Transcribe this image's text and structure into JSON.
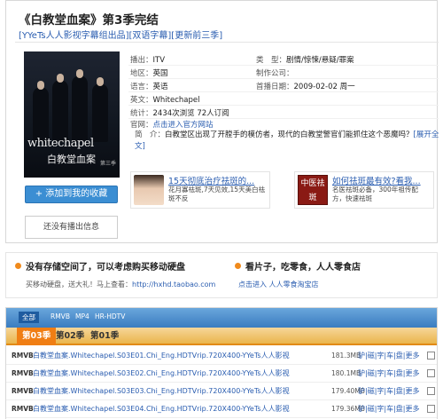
{
  "show": {
    "title": "《白教堂血案》第3季完结",
    "subtitle": "[YYeTs人人影视字幕组出品][双语字幕][更新前三季]"
  },
  "poster": {
    "title_en": "whitechapel",
    "title_cn": "白教堂血案",
    "tag": "第三季"
  },
  "info": {
    "rows_left": [
      {
        "label": "播出：",
        "value": "ITV"
      },
      {
        "label": "地区：",
        "value": "英国"
      },
      {
        "label": "语言：",
        "value": "英语"
      },
      {
        "label": "英文：",
        "value": "Whitechapel"
      },
      {
        "label": "统计：",
        "value": "2434次浏览 72人订阅"
      },
      {
        "label": "官网：",
        "value": "点击进入官方网站"
      }
    ],
    "rows_right": [
      {
        "label": "类　型：",
        "value": "剧情/惊悚/悬疑/罪案"
      },
      {
        "label": "制作公司：",
        "value": ""
      },
      {
        "label": "首播日期：",
        "value": "2009-02-02  周一"
      }
    ],
    "synopsis_label": "简　介：",
    "synopsis_text": "白教堂区出现了开膛手的模仿者，现代的白教堂警官们能抓住这个恶魔吗？",
    "synopsis_more": "[展开全文]"
  },
  "buttons": {
    "add_favorite": "+ 添加到我的收藏",
    "no_schedule": "还没有播出信息"
  },
  "ads": [
    {
      "headline": "15天彻底治疗祛斑的...",
      "body": "花月寡祛斑,7天见效,15天美白祛斑不反"
    },
    {
      "headline": "如何祛斑最有效?看我...",
      "body": "名医祛斑必备，300年祖传配方，快速祛斑",
      "thumb_text": "中医祛斑"
    }
  ],
  "promo": {
    "left_head": "没有存储空间了，可以考虑购买移动硬盘",
    "left_sub": "买移动硬盘，送大礼！马上查看：",
    "left_link": "http://hxhd.taobao.com",
    "right_head": "看片子，吃零食，人人零食店",
    "right_sub": "点击进入 人人零食淘宝店"
  },
  "resources": {
    "formats": [
      "全部",
      "RMVB",
      "MP4",
      "HR-HDTV"
    ],
    "seasons": [
      "第03季",
      "第02季",
      "第01季"
    ],
    "files": [
      {
        "format": "RMVB",
        "name": "白教堂血案.Whitechapel.S03E01.Chi_Eng.HDTVrip.720X400-YYeTs人人影视",
        "size": "181.3MB",
        "actions": "驴|磁|字|车|盘|更多"
      },
      {
        "format": "RMVB",
        "name": "白教堂血案.Whitechapel.S03E02.Chi_Eng.HDTVrip.720X400-YYeTs人人影视",
        "size": "180.1MB",
        "actions": "驴|磁|字|车|盘|更多"
      },
      {
        "format": "RMVB",
        "name": "白教堂血案.Whitechapel.S03E03.Chi_Eng.HDTVrip.720X400-YYeTs人人影视",
        "size": "179.40MB",
        "actions": "驴|磁|字|车|盘|更多"
      },
      {
        "format": "RMVB",
        "name": "白教堂血案.Whitechapel.S03E04.Chi_Eng.HDTVrip.720X400-YYeTs人人影视",
        "size": "179.36MB",
        "actions": "驴|磁|字|车|盘|更多"
      }
    ]
  },
  "colors": {
    "link": "#2a5db0",
    "accent_orange": "#f07e14",
    "button_blue": "#3b8ed3"
  }
}
